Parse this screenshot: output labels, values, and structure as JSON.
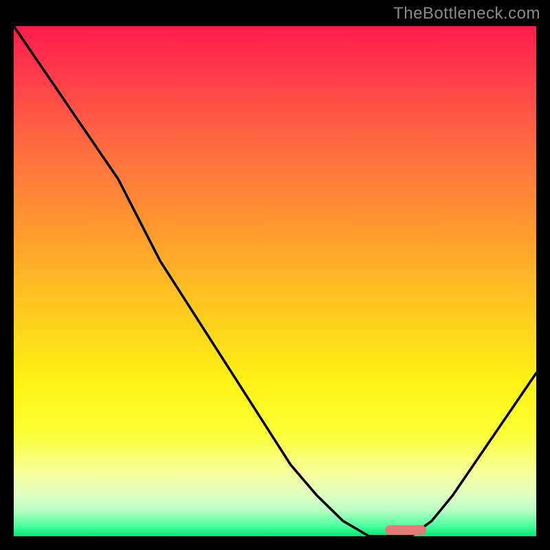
{
  "watermark": "TheBottleneck.com",
  "colors": {
    "frame": "#000000",
    "curve": "#000000",
    "marker": "#e37a78",
    "watermark": "#8b8b8b",
    "gradient_top": "#ff1a4b",
    "gradient_mid1": "#ff9a2f",
    "gradient_mid2": "#fff312",
    "gradient_bottom": "#00e676"
  },
  "chart_data": {
    "type": "line",
    "title": "",
    "xlabel": "",
    "ylabel": "",
    "x": [
      0.0,
      0.04,
      0.08,
      0.12,
      0.16,
      0.2,
      0.24,
      0.28,
      0.33,
      0.38,
      0.43,
      0.48,
      0.53,
      0.58,
      0.63,
      0.68,
      0.72,
      0.76,
      0.8,
      0.84,
      0.88,
      0.92,
      0.96,
      1.0
    ],
    "values_bottleneck_pct": [
      100,
      94,
      88,
      82,
      76,
      70,
      62,
      54,
      46,
      38,
      30,
      22,
      14,
      8,
      3,
      0,
      0,
      0,
      3,
      8,
      14,
      20,
      26,
      32
    ],
    "xlim": [
      0,
      1
    ],
    "ylim": [
      0,
      100
    ],
    "marker": {
      "x_start": 0.71,
      "x_end": 0.79,
      "y": 0
    },
    "notes": "Ticks and axis labels are not rendered in the image; curve is approximate (read from pixels)."
  }
}
